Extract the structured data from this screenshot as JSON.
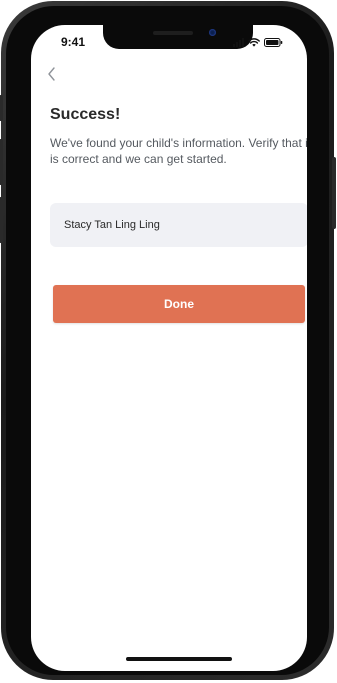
{
  "status_bar": {
    "time": "9:41"
  },
  "nav": {
    "back_icon": "chevron-left-icon"
  },
  "main": {
    "title": "Success!",
    "subtitle": "We've found your child's information. Verify that it is correct and we can get started.",
    "child_name": "Stacy Tan Ling Ling",
    "done_label": "Done"
  },
  "colors": {
    "accent": "#e07253",
    "field_background": "#f0f1f5",
    "title_text": "#2a2a2a",
    "body_text": "#555a60"
  }
}
